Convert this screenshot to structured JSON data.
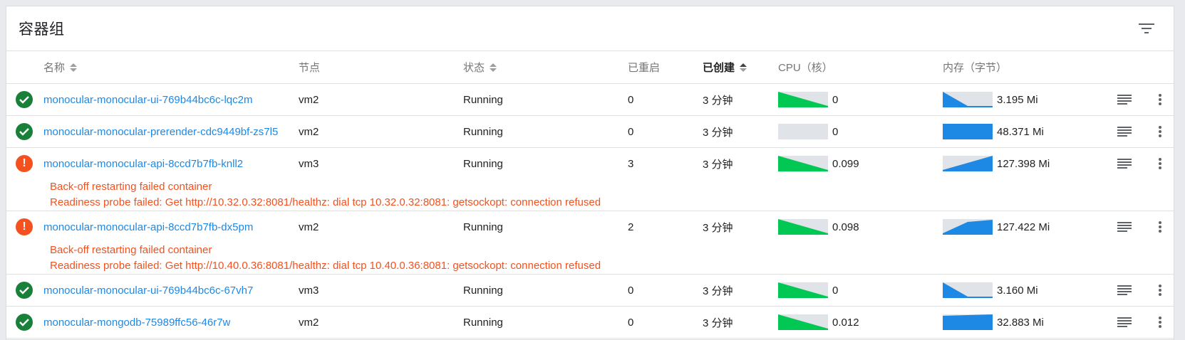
{
  "card": {
    "title": "容器组",
    "filter_icon": "filter-list-icon"
  },
  "columns": {
    "name": "名称",
    "node": "节点",
    "status": "状态",
    "restarts": "已重启",
    "created": "已创建",
    "cpu": "CPU（核）",
    "memory": "内存（字节）"
  },
  "colors": {
    "link": "#1e88e5",
    "ok": "#188038",
    "error": "#f4511e",
    "cpu": "#00c853",
    "memory": "#1e88e5",
    "track": "#e0e3e7"
  },
  "rows": [
    {
      "state": "ok",
      "name": "monocular-monocular-ui-769b44bc6c-lqc2m",
      "node": "vm2",
      "status": "Running",
      "restarts": "0",
      "created": "3 分钟",
      "cpu": "0",
      "memory": "3.195 Mi",
      "cpu_spark": "falling",
      "mem_spark": "falling-low",
      "warnings": []
    },
    {
      "state": "ok",
      "name": "monocular-monocular-prerender-cdc9449bf-zs7l5",
      "node": "vm2",
      "status": "Running",
      "restarts": "0",
      "created": "3 分钟",
      "cpu": "0",
      "memory": "48.371 Mi",
      "cpu_spark": "empty",
      "mem_spark": "full",
      "warnings": []
    },
    {
      "state": "error",
      "name": "monocular-monocular-api-8ccd7b7fb-knll2",
      "node": "vm3",
      "status": "Running",
      "restarts": "3",
      "created": "3 分钟",
      "cpu": "0.099",
      "memory": "127.398 Mi",
      "cpu_spark": "falling",
      "mem_spark": "rising",
      "warnings": [
        "Back-off restarting failed container",
        "Readiness probe failed: Get http://10.32.0.32:8081/healthz: dial tcp 10.32.0.32:8081: getsockopt: connection refused"
      ]
    },
    {
      "state": "error",
      "name": "monocular-monocular-api-8ccd7b7fb-dx5pm",
      "node": "vm2",
      "status": "Running",
      "restarts": "2",
      "created": "3 分钟",
      "cpu": "0.098",
      "memory": "127.422 Mi",
      "cpu_spark": "falling",
      "mem_spark": "rising-plateau",
      "warnings": [
        "Back-off restarting failed container",
        "Readiness probe failed: Get http://10.40.0.36:8081/healthz: dial tcp 10.40.0.36:8081: getsockopt: connection refused"
      ]
    },
    {
      "state": "ok",
      "name": "monocular-monocular-ui-769b44bc6c-67vh7",
      "node": "vm3",
      "status": "Running",
      "restarts": "0",
      "created": "3 分钟",
      "cpu": "0",
      "memory": "3.160 Mi",
      "cpu_spark": "falling",
      "mem_spark": "falling-low",
      "warnings": []
    },
    {
      "state": "ok",
      "name": "monocular-mongodb-75989ffc56-46r7w",
      "node": "vm2",
      "status": "Running",
      "restarts": "0",
      "created": "3 分钟",
      "cpu": "0.012",
      "memory": "32.883 Mi",
      "cpu_spark": "falling",
      "mem_spark": "near-full",
      "warnings": []
    }
  ]
}
